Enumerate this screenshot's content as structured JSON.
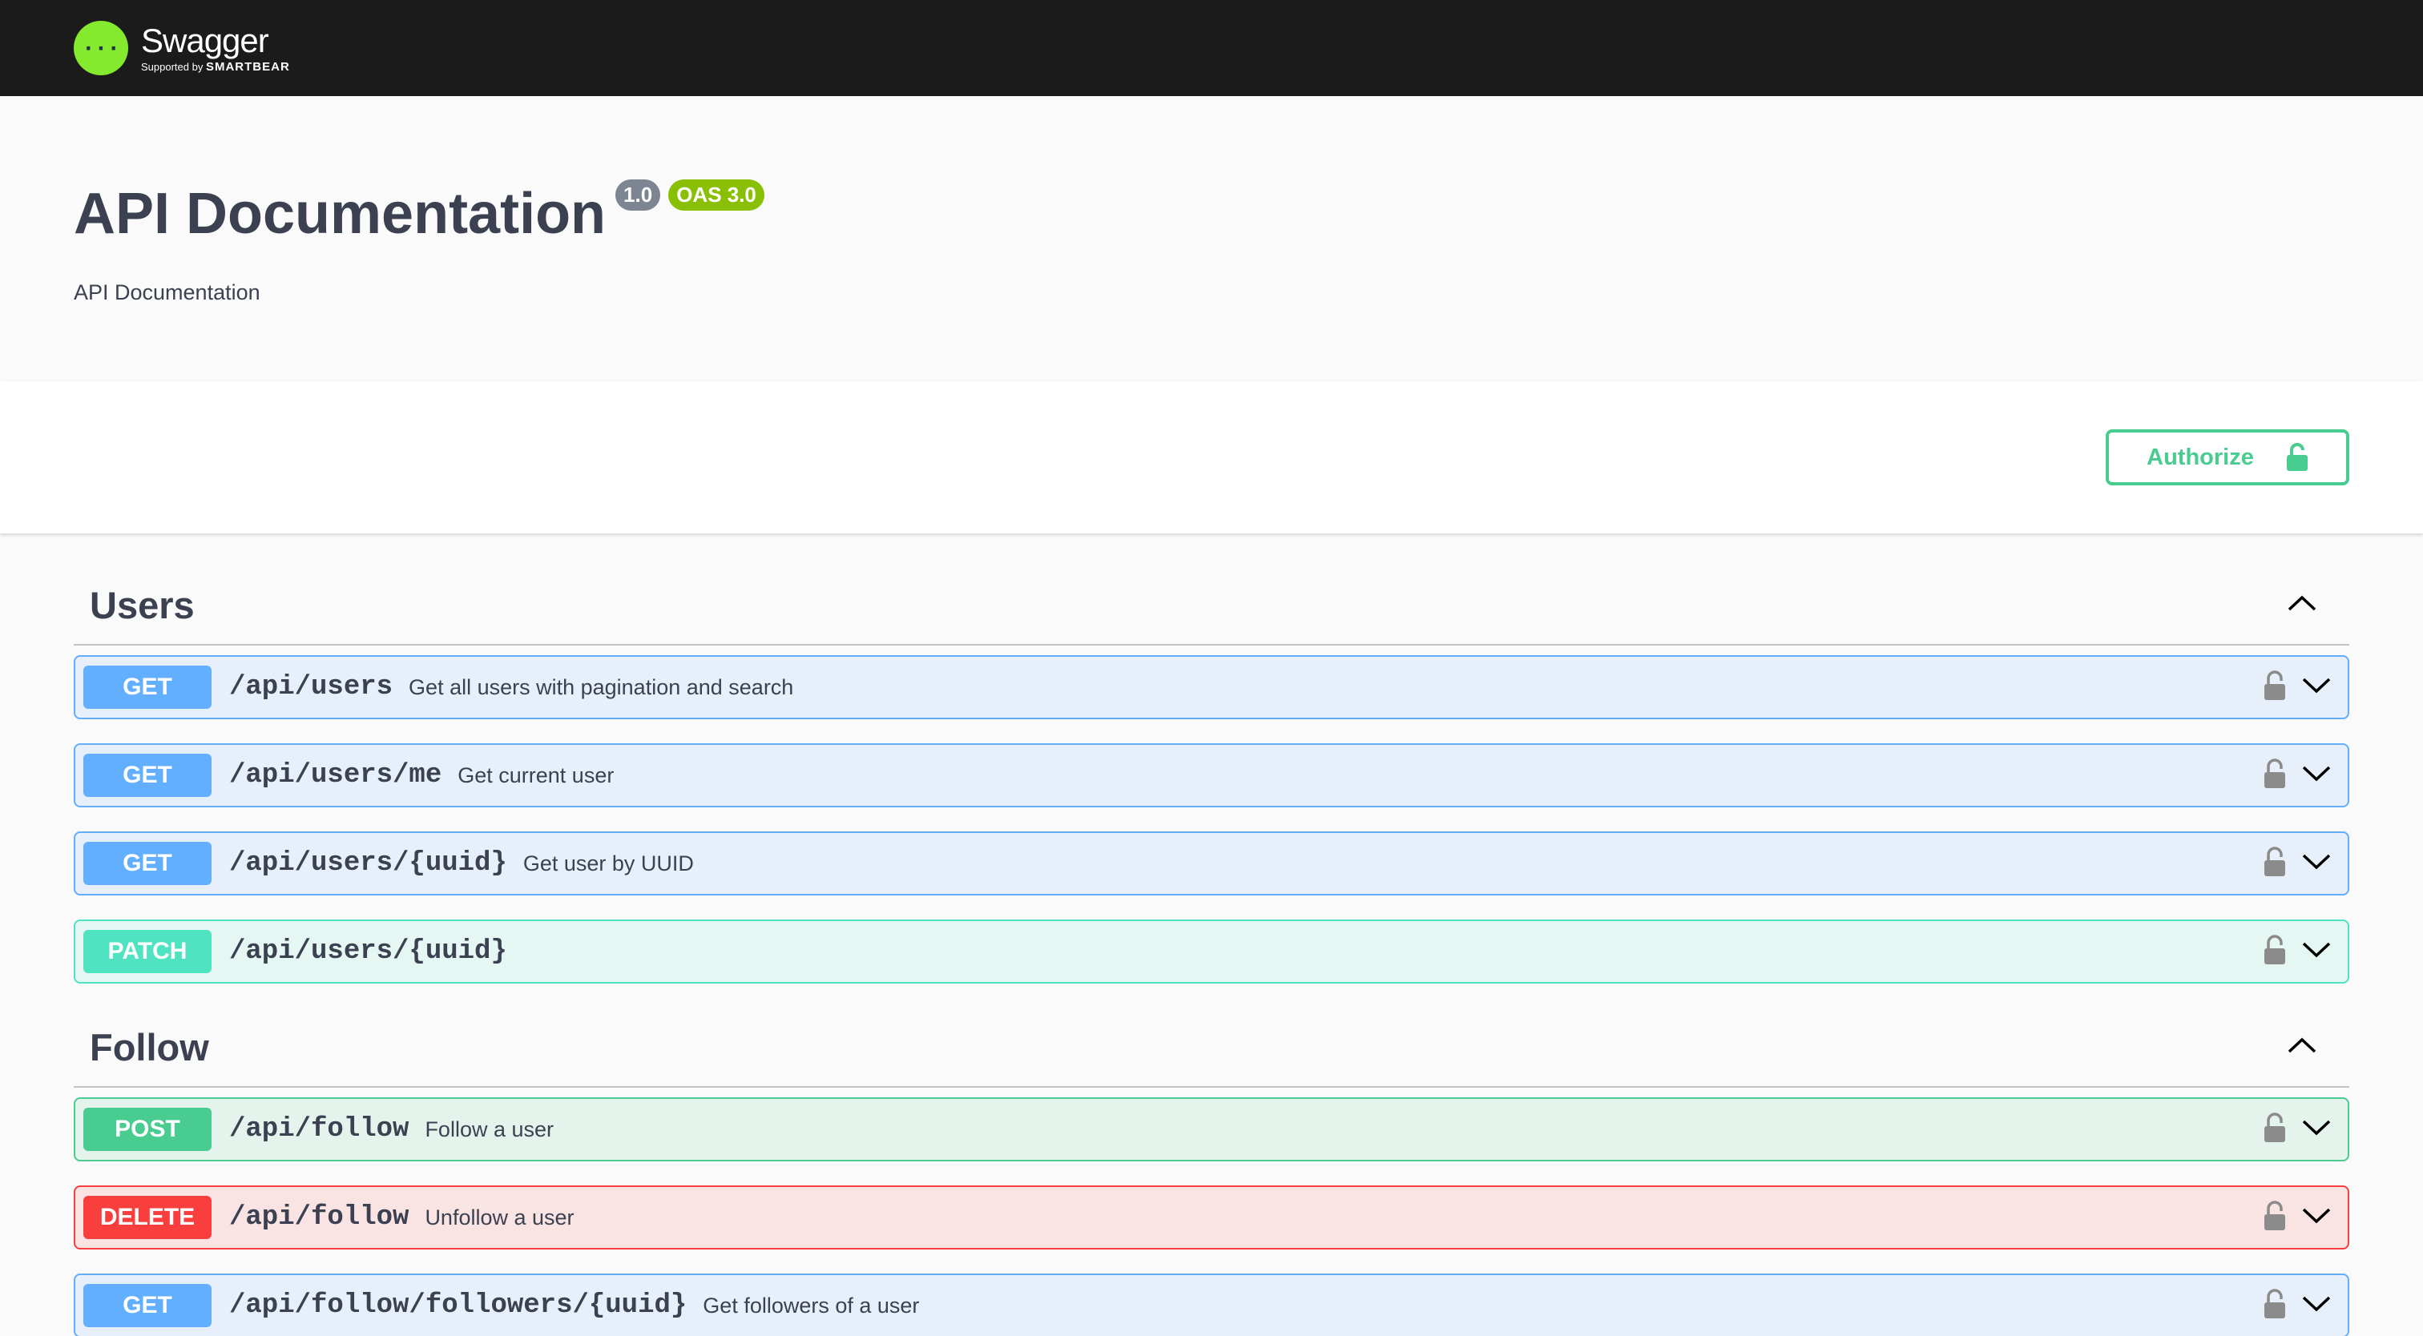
{
  "topbar": {
    "logo_name": "Swagger",
    "logo_sub_prefix": "Supported by",
    "logo_sub_brand": "SMARTBEAR",
    "logo_glyph": "{···}"
  },
  "info": {
    "title": "API Documentation",
    "version": "1.0",
    "oas": "OAS 3.0",
    "description": "API Documentation"
  },
  "scheme": {
    "authorize_label": "Authorize"
  },
  "colors": {
    "get": "#61affe",
    "patch": "#50e3c2",
    "post": "#49cc90",
    "delete": "#f93e3e"
  },
  "tags": [
    {
      "name": "Users",
      "operations": [
        {
          "method": "GET",
          "path": "/api/users",
          "summary": "Get all users with pagination and search"
        },
        {
          "method": "GET",
          "path": "/api/users/me",
          "summary": "Get current user"
        },
        {
          "method": "GET",
          "path": "/api/users/{uuid}",
          "summary": "Get user by UUID"
        },
        {
          "method": "PATCH",
          "path": "/api/users/{uuid}",
          "summary": ""
        }
      ]
    },
    {
      "name": "Follow",
      "operations": [
        {
          "method": "POST",
          "path": "/api/follow",
          "summary": "Follow a user"
        },
        {
          "method": "DELETE",
          "path": "/api/follow",
          "summary": "Unfollow a user"
        },
        {
          "method": "GET",
          "path": "/api/follow/followers/{uuid}",
          "summary": "Get followers of a user"
        }
      ]
    }
  ]
}
